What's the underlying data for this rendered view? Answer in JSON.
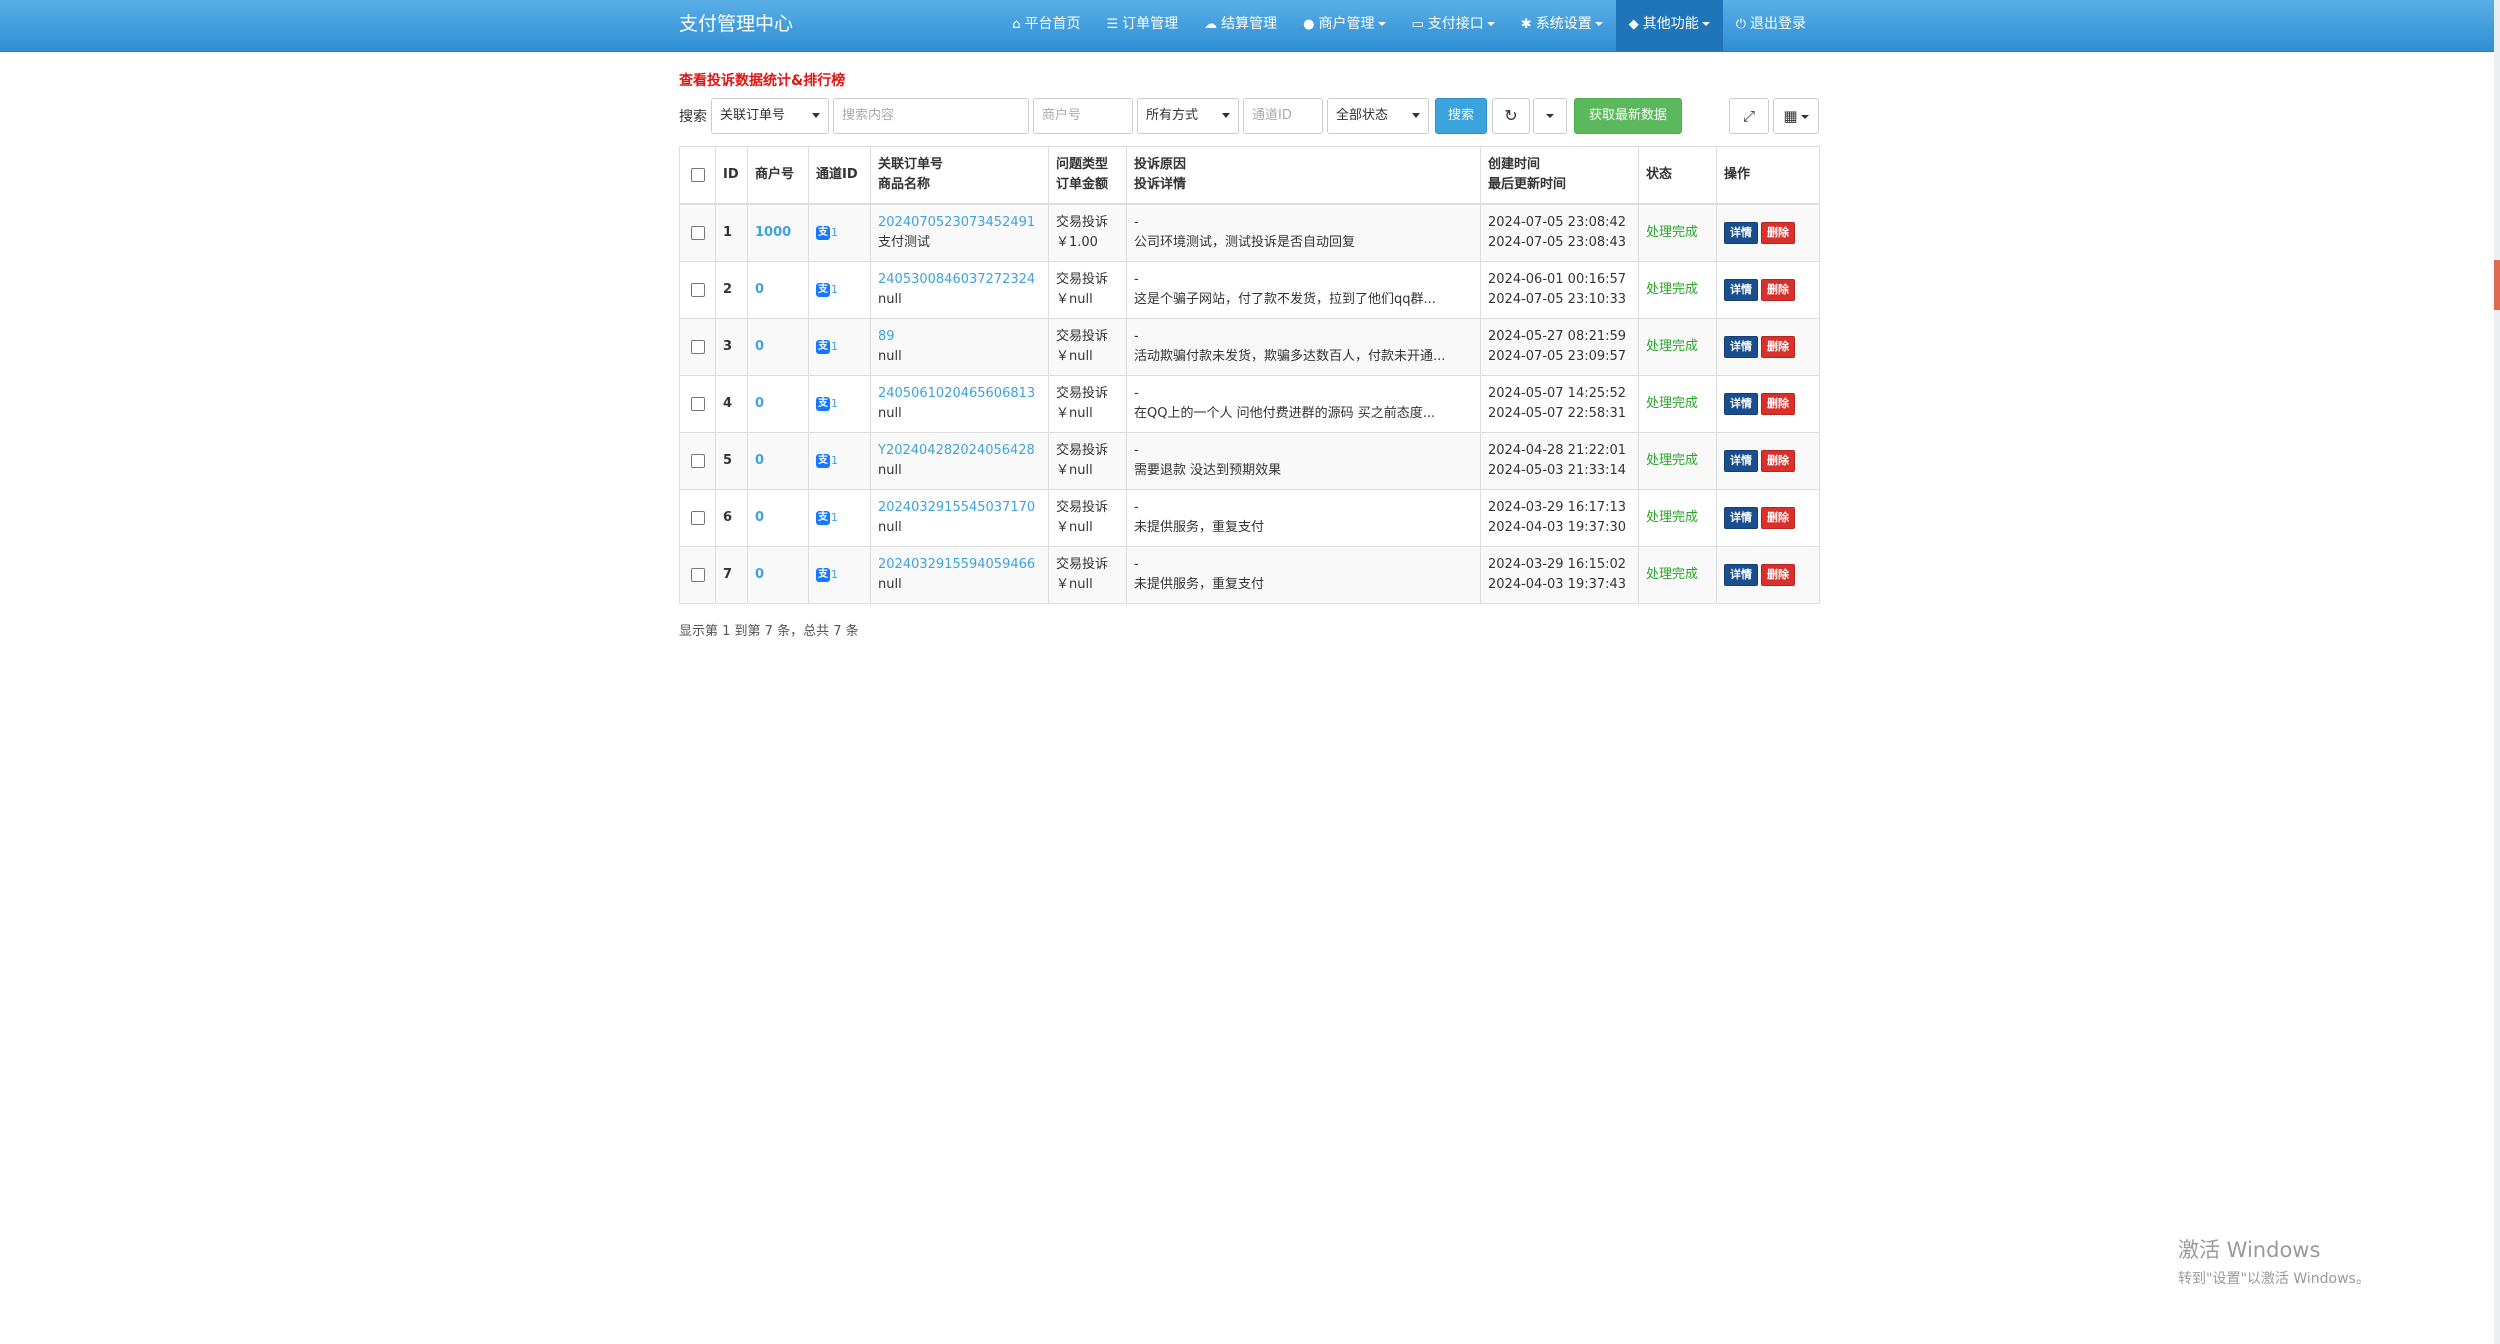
{
  "navbar": {
    "brand": "支付管理中心",
    "items": [
      {
        "icon": "⌂",
        "label": "平台首页",
        "dropdown": false
      },
      {
        "icon": "☰",
        "label": "订单管理",
        "dropdown": false
      },
      {
        "icon": "☁",
        "label": "结算管理",
        "dropdown": false
      },
      {
        "icon": "●",
        "label": "商户管理",
        "dropdown": true
      },
      {
        "icon": "▭",
        "label": "支付接口",
        "dropdown": true
      },
      {
        "icon": "✱",
        "label": "系统设置",
        "dropdown": true
      },
      {
        "icon": "◆",
        "label": "其他功能",
        "dropdown": true,
        "active": true
      },
      {
        "icon": "⏻",
        "label": "退出登录",
        "dropdown": false
      }
    ]
  },
  "stats_link": "查看投诉数据统计&排行榜",
  "toolbar": {
    "label": "搜索",
    "search_field_select": "关联订单号",
    "search_content_placeholder": "搜索内容",
    "merchant_placeholder": "商户号",
    "method_select": "所有方式",
    "channel_placeholder": "通道ID",
    "status_select": "全部状态",
    "search_button": "搜索",
    "refresh_icon": "↻",
    "fetch_button": "获取最新数据",
    "fullscreen_icon": "⤢",
    "columns_icon": "▦"
  },
  "table": {
    "headers": {
      "id": "ID",
      "merchant": "商户号",
      "channel": "通道ID",
      "order_no": "关联订单号",
      "product": "商品名称",
      "type": "问题类型",
      "amount": "订单金额",
      "reason": "投诉原因",
      "detail": "投诉详情",
      "created": "创建时间",
      "updated": "最后更新时间",
      "status": "状态",
      "actions": "操作"
    },
    "rows": [
      {
        "id": "1",
        "merchant": "1000",
        "channel": "1",
        "order_no": "2024070523073452491",
        "product": "支付测试",
        "type": "交易投诉",
        "amount": "￥1.00",
        "reason": "-",
        "detail": "公司环境测试，测试投诉是否自动回复",
        "created": "2024-07-05 23:08:42",
        "updated": "2024-07-05 23:08:43",
        "status": "处理完成",
        "detail_btn": "详情",
        "delete_btn": "删除"
      },
      {
        "id": "2",
        "merchant": "0",
        "channel": "1",
        "order_no": "2405300846037272324",
        "product": "null",
        "type": "交易投诉",
        "amount": "￥null",
        "reason": "-",
        "detail": "这是个骗子网站，付了款不发货，拉到了他们qq群...",
        "created": "2024-06-01 00:16:57",
        "updated": "2024-07-05 23:10:33",
        "status": "处理完成",
        "detail_btn": "详情",
        "delete_btn": "删除"
      },
      {
        "id": "3",
        "merchant": "0",
        "channel": "1",
        "order_no": "89",
        "product": "null",
        "type": "交易投诉",
        "amount": "￥null",
        "reason": "-",
        "detail": "活动欺骗付款未发货，欺骗多达数百人，付款未开通...",
        "created": "2024-05-27 08:21:59",
        "updated": "2024-07-05 23:09:57",
        "status": "处理完成",
        "detail_btn": "详情",
        "delete_btn": "删除"
      },
      {
        "id": "4",
        "merchant": "0",
        "channel": "1",
        "order_no": "2405061020465606813",
        "product": "null",
        "type": "交易投诉",
        "amount": "￥null",
        "reason": "-",
        "detail": "在QQ上的一个人 问他付费进群的源码 买之前态度...",
        "created": "2024-05-07 14:25:52",
        "updated": "2024-05-07 22:58:31",
        "status": "处理完成",
        "detail_btn": "详情",
        "delete_btn": "删除"
      },
      {
        "id": "5",
        "merchant": "0",
        "channel": "1",
        "order_no": "Y202404282024056428",
        "product": "null",
        "type": "交易投诉",
        "amount": "￥null",
        "reason": "-",
        "detail": "需要退款 没达到预期效果",
        "created": "2024-04-28 21:22:01",
        "updated": "2024-05-03 21:33:14",
        "status": "处理完成",
        "detail_btn": "详情",
        "delete_btn": "删除"
      },
      {
        "id": "6",
        "merchant": "0",
        "channel": "1",
        "order_no": "2024032915545037170",
        "product": "null",
        "type": "交易投诉",
        "amount": "￥null",
        "reason": "-",
        "detail": "未提供服务，重复支付",
        "created": "2024-03-29 16:17:13",
        "updated": "2024-04-03 19:37:30",
        "status": "处理完成",
        "detail_btn": "详情",
        "delete_btn": "删除"
      },
      {
        "id": "7",
        "merchant": "0",
        "channel": "1",
        "order_no": "2024032915594059466",
        "product": "null",
        "type": "交易投诉",
        "amount": "￥null",
        "reason": "-",
        "detail": "未提供服务，重复支付",
        "created": "2024-03-29 16:15:02",
        "updated": "2024-04-03 19:37:43",
        "status": "处理完成",
        "detail_btn": "详情",
        "delete_btn": "删除"
      }
    ]
  },
  "pager_info": "显示第 1 到第 7 条，总共 7 条",
  "watermark": {
    "title": "激活 Windows",
    "subtitle": "转到\"设置\"以激活 Windows。"
  },
  "colors": {
    "nav": "#3a9be0",
    "primary": "#3ca3dc",
    "success": "#5cb85c",
    "danger": "#d9302c",
    "detail_btn": "#1a4f8f",
    "status_done": "#2aa52a",
    "stats_link": "#e01515"
  }
}
